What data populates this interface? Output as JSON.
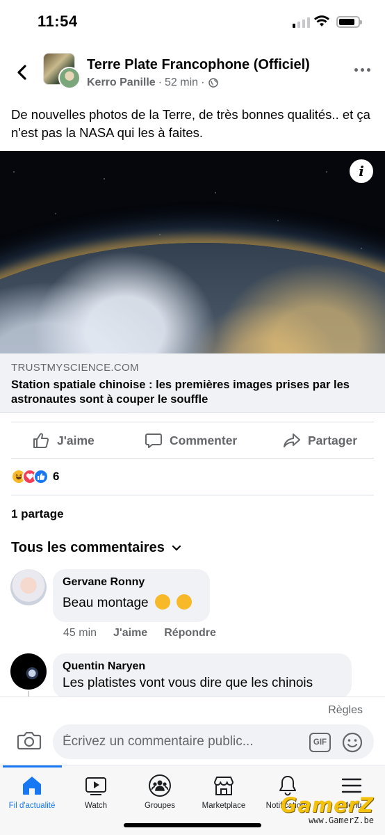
{
  "status_bar": {
    "time": "11:54"
  },
  "post": {
    "group_name": "Terre Plate Francophone (Officiel)",
    "author": "Kerro Panille",
    "time_ago": "52 min",
    "separator": "·",
    "text": "De nouvelles photos de la Terre, de très bonnes qualités.. et ça n'est pas la NASA qui les à faites.",
    "link": {
      "domain": "TRUSTMYSCIENCE.COM",
      "title": "Station spatiale chinoise : les premières images prises par les astronautes sont à couper le souffle"
    },
    "actions": {
      "like": "J'aime",
      "comment": "Commenter",
      "share": "Partager"
    },
    "reactions": {
      "count": "6",
      "types": [
        "haha",
        "love",
        "like"
      ]
    },
    "shares": "1 partage",
    "comments_filter": "Tous les commentaires"
  },
  "comments": [
    {
      "name": "Gervane Ronny",
      "text": "Beau montage",
      "emojis": [
        "winking-face",
        "grinning-sweat-face"
      ],
      "time": "45 min",
      "like_label": "J'aime",
      "reply_label": "Répondre"
    },
    {
      "name": "Quentin Naryen",
      "text": "Les platistes vont vous dire que les chinois"
    }
  ],
  "composer": {
    "rules": "Règles",
    "placeholder": "Écrivez un commentaire public...",
    "gif_label": "GIF"
  },
  "tab_bar": {
    "items": [
      {
        "label": "Fil d'actualité",
        "icon": "home-icon",
        "active": true
      },
      {
        "label": "Watch",
        "icon": "watch-icon",
        "active": false
      },
      {
        "label": "Groupes",
        "icon": "groups-icon",
        "active": false
      },
      {
        "label": "Marketplace",
        "icon": "marketplace-icon",
        "active": false
      },
      {
        "label": "Notifications",
        "icon": "bell-icon",
        "active": false
      },
      {
        "label": "Menu",
        "icon": "menu-icon",
        "active": false
      }
    ]
  },
  "watermark": {
    "logo": "GamerZ",
    "url": "www.GamerZ.be"
  },
  "colors": {
    "accent": "#1877f2",
    "secondary_text": "#65676b",
    "bubble": "#f0f2f5"
  }
}
